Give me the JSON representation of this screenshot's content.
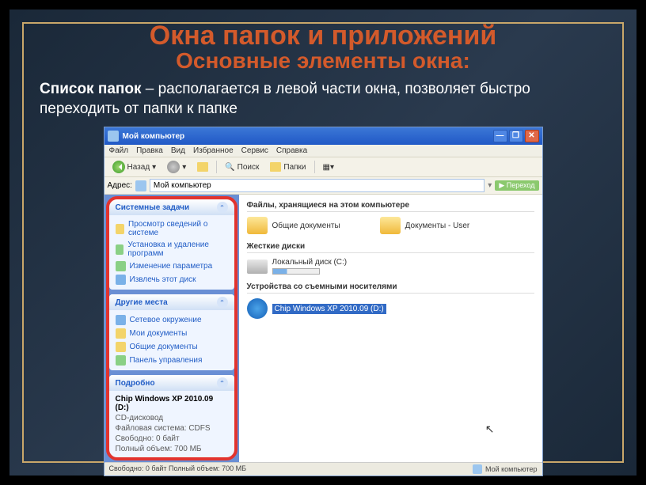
{
  "slide": {
    "title1": "Окна папок и приложений",
    "title2": "Основные элементы окна:",
    "desc_bold": "Список папок",
    "desc_rest": " – располагается в левой части окна, позволяет быстро переходить от папки к папке"
  },
  "window": {
    "title": "Мой компьютер",
    "menus": [
      "Файл",
      "Правка",
      "Вид",
      "Избранное",
      "Сервис",
      "Справка"
    ],
    "toolbar": {
      "back": "Назад",
      "search": "Поиск",
      "folders": "Папки"
    },
    "address": {
      "label": "Адрес:",
      "value": "Мой компьютер",
      "go": "Переход"
    },
    "side": {
      "tasks": {
        "title": "Системные задачи",
        "items": [
          "Просмотр сведений о системе",
          "Установка и удаление программ",
          "Изменение параметра",
          "Извлечь этот диск"
        ]
      },
      "places": {
        "title": "Другие места",
        "items": [
          "Сетевое окружение",
          "Мои документы",
          "Общие документы",
          "Панель управления"
        ]
      },
      "details": {
        "title": "Подробно",
        "heading": "Chip Windows XP 2010.09 (D:)",
        "type": "CD-дисковод",
        "fs": "Файловая система: CDFS",
        "free": "Свободно: 0 байт",
        "total": "Полный объем: 700 МБ"
      }
    },
    "main": {
      "sect1": {
        "title": "Файлы, хранящиеся на этом компьютере",
        "items": [
          "Общие документы",
          "Документы - User"
        ]
      },
      "sect2": {
        "title": "Жесткие диски",
        "items": [
          "Локальный диск (C:)"
        ]
      },
      "sect3": {
        "title": "Устройства со съемными носителями",
        "items": [
          "Chip Windows XP 2010.09 (D:)"
        ]
      }
    },
    "status": {
      "left": "Свободно: 0 байт Полный объем: 700 МБ",
      "right": "Мой компьютер"
    }
  }
}
